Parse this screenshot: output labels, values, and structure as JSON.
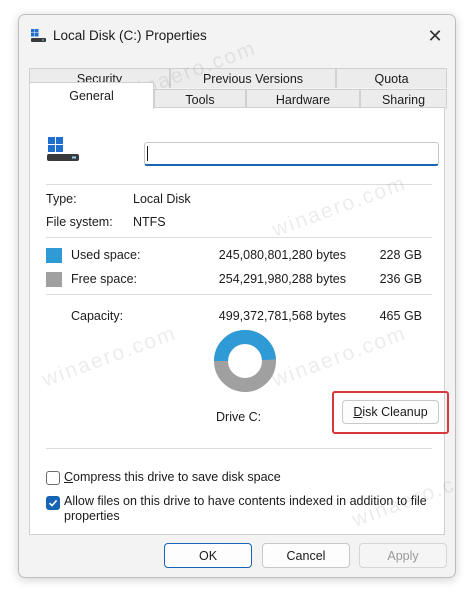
{
  "window": {
    "title": "Local Disk (C:) Properties",
    "close_symbol": "✕"
  },
  "tabs": {
    "row1": [
      "Security",
      "Previous Versions",
      "Quota"
    ],
    "row2": [
      "General",
      "Tools",
      "Hardware",
      "Sharing"
    ],
    "active": "General"
  },
  "general": {
    "name_value": "",
    "type_label": "Type:",
    "type_value": "Local Disk",
    "fs_label": "File system:",
    "fs_value": "NTFS",
    "used": {
      "label": "Used space:",
      "bytes": "245,080,801,280 bytes",
      "size": "228 GB",
      "color": "#2f9bd6"
    },
    "free": {
      "label": "Free space:",
      "bytes": "254,291,980,288 bytes",
      "size": "236 GB",
      "color": "#a0a0a0"
    },
    "capacity": {
      "label": "Capacity:",
      "bytes": "499,372,781,568 bytes",
      "size": "465 GB"
    },
    "used_fraction": 0.4908,
    "drive_label": "Drive C:",
    "cleanup_button": "Disk Cleanup",
    "compress_label": "Compress this drive to save disk space",
    "compress_checked": false,
    "index_label_line1": "Allow files on this drive to have contents indexed in addition to file",
    "index_label_line2": "properties",
    "index_checked": true
  },
  "buttons": {
    "ok": "OK",
    "cancel": "Cancel",
    "apply": "Apply"
  },
  "watermark": "winaero.com",
  "icons": {
    "title_icon": "drive-icon",
    "drive_icon": "hard-drive-icon",
    "close_icon": "close-icon",
    "check_icon": "checkmark-icon"
  }
}
